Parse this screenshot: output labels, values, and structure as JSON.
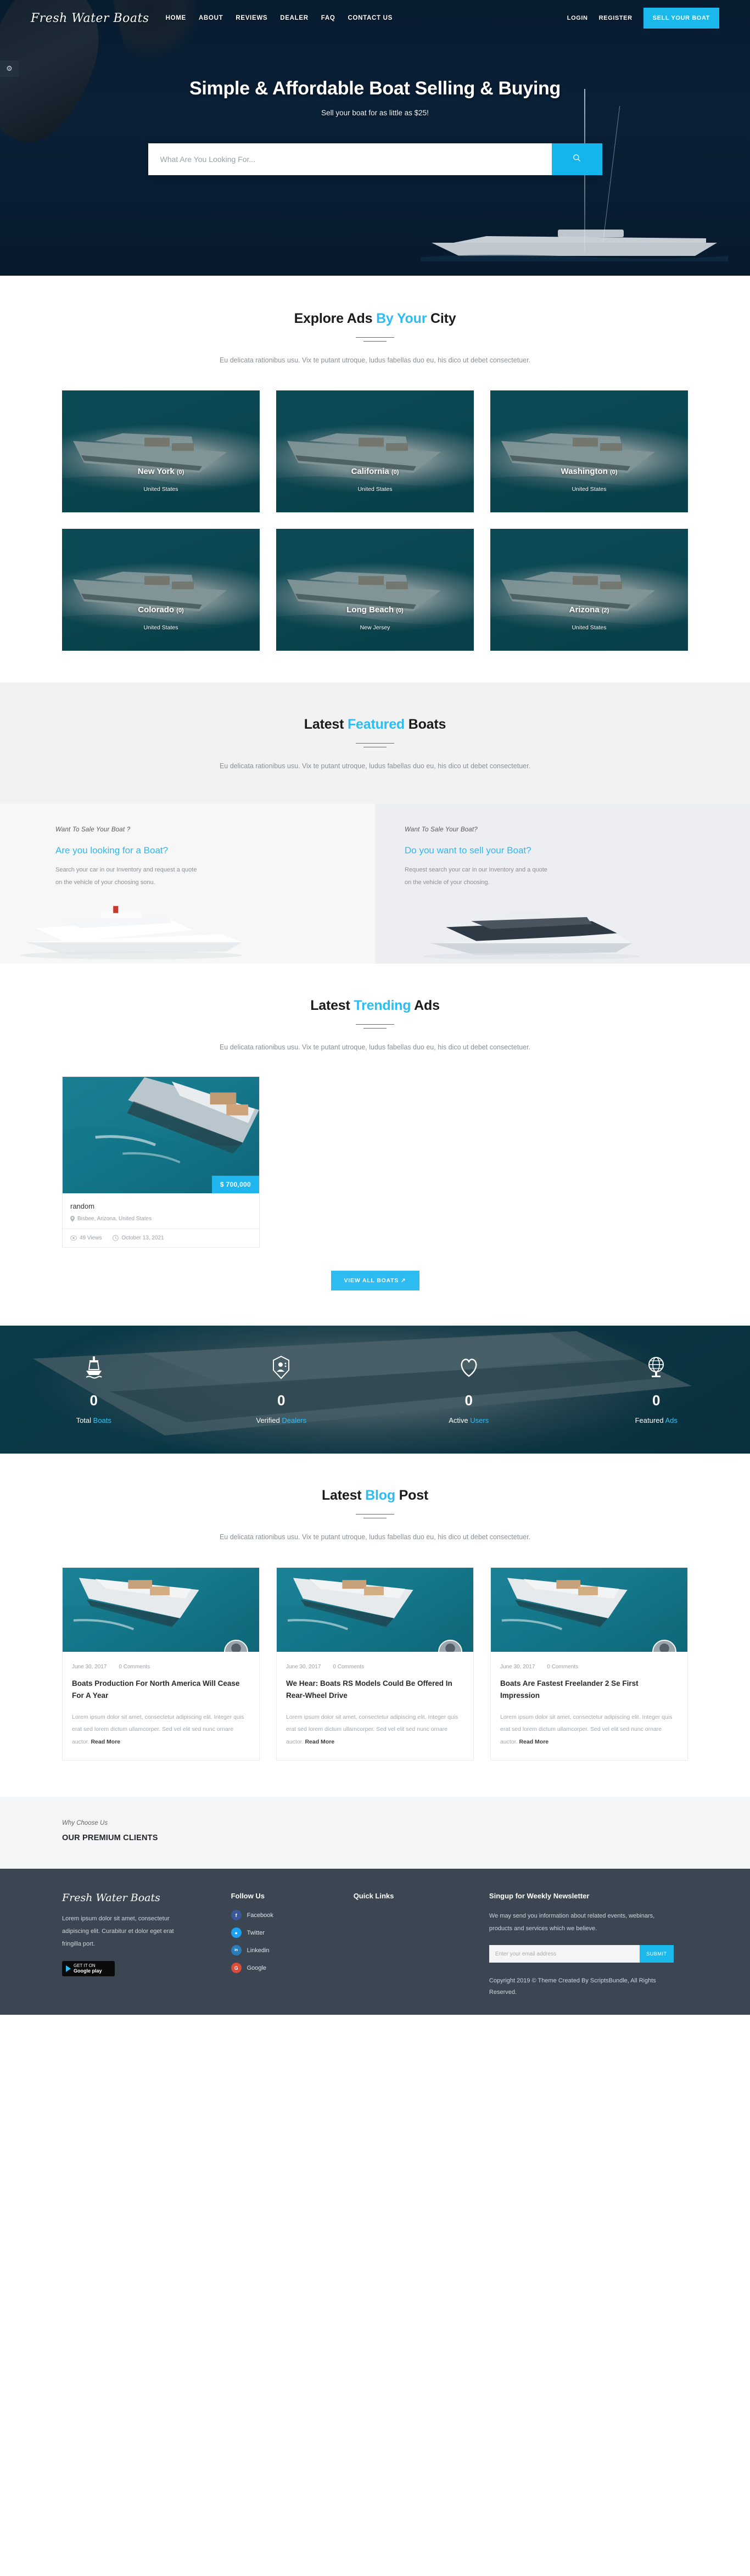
{
  "brand": {
    "name": "Fresh Water Boats"
  },
  "nav": {
    "links": [
      {
        "label": "HOME"
      },
      {
        "label": "ABOUT"
      },
      {
        "label": "REVIEWS"
      },
      {
        "label": "DEALER"
      },
      {
        "label": "FAQ"
      },
      {
        "label": "CONTACT US"
      }
    ],
    "login_label": "LOGIN",
    "register_label": "REGISTER",
    "sell_label": "SELL YOUR BOAT",
    "settings_icon": "gear-icon"
  },
  "hero": {
    "title": "Simple & Affordable Boat Selling & Buying",
    "subtitle": "Sell your boat for as little as $25!",
    "search_placeholder": "What Are You Looking For...",
    "search_value": "",
    "search_icon": "search-icon"
  },
  "city_section": {
    "title_pre": "Explore Ads ",
    "title_hl": "By Your",
    "title_post": " City",
    "desc": "Eu delicata rationibus usu. Vix te putant utroque, ludus fabellas duo eu, his dico ut debet consectetuer.",
    "cards": [
      {
        "name": "New York",
        "count": "(0)",
        "country": "United States"
      },
      {
        "name": "California",
        "count": "(0)",
        "country": "United States"
      },
      {
        "name": "Washington",
        "count": "(0)",
        "country": "United States"
      },
      {
        "name": "Colorado",
        "count": "(0)",
        "country": "United States"
      },
      {
        "name": "Long Beach",
        "count": "(0)",
        "country": "New Jersey"
      },
      {
        "name": "Arizona",
        "count": "(2)",
        "country": "United States"
      }
    ]
  },
  "featured_section": {
    "title_pre": "Latest ",
    "title_hl": "Featured",
    "title_post": " Boats",
    "desc": "Eu delicata rationibus usu. Vix te putant utroque, ludus fabellas duo eu, his dico ut debet consectetuer.",
    "promos": [
      {
        "kicker": "Want To Sale Your Boat ?",
        "title": "Are you looking for a Boat?",
        "text": "Search your car in our Inventory and request a quote on the vehicle of your choosing sonu."
      },
      {
        "kicker": "Want To Sale Your Boat?",
        "title": "Do you want to sell your Boat?",
        "text": "Request search your car in our Inventory and a quote on the vehicle of your choosing."
      }
    ]
  },
  "trending_section": {
    "title_pre": "Latest ",
    "title_hl": "Trending",
    "title_post": " Ads",
    "desc": "Eu delicata rationibus usu. Vix te putant utroque, ludus fabellas duo eu, his dico ut debet consectetuer.",
    "view_all_label": "VIEW ALL BOATS",
    "view_all_icon": "external-link-icon",
    "ads": [
      {
        "price": "$ 700,000",
        "title": "random",
        "location": "Bisbee, Arizona, United States",
        "views": "49 Views",
        "date": "October 13, 2021",
        "location_icon": "map-pin-icon",
        "views_icon": "eye-icon",
        "date_icon": "clock-icon"
      }
    ]
  },
  "stats": [
    {
      "icon": "ship-icon",
      "value": "0",
      "label_pre": "Total ",
      "label_hl": "Boats"
    },
    {
      "icon": "badge-user-icon",
      "value": "0",
      "label_pre": "Verified ",
      "label_hl": "Dealers"
    },
    {
      "icon": "heart-icon",
      "value": "0",
      "label_pre": "Active ",
      "label_hl": "Users"
    },
    {
      "icon": "globe-icon",
      "value": "0",
      "label_pre": "Featured ",
      "label_hl": "Ads"
    }
  ],
  "blog_section": {
    "title_pre": "Latest ",
    "title_hl": "Blog",
    "title_post": " Post",
    "desc": "Eu delicata rationibus usu. Vix te putant utroque, ludus fabellas duo eu, his dico ut debet consectetuer.",
    "posts": [
      {
        "date": "June 30, 2017",
        "comments": "0 Comments",
        "title": "Boats Production For North America Will Cease For A Year",
        "text": "Lorem ipsum dolor sit amet, consectetur adipiscing elit. Integer quis erat sed lorem dictum ullamcorper. Sed vel elit sed nunc ornare auctor.",
        "read_more": "Read More"
      },
      {
        "date": "June 30, 2017",
        "comments": "0 Comments",
        "title": "We Hear: Boats RS Models Could Be Offered In Rear-Wheel Drive",
        "text": "Lorem ipsum dolor sit amet, consectetur adipiscing elit. Integer quis erat sed lorem dictum ullamcorper. Sed vel elit sed nunc ornare auctor.",
        "read_more": "Read More"
      },
      {
        "date": "June 30, 2017",
        "comments": "0 Comments",
        "title": "Boats Are Fastest Freelander 2 Se First Impression",
        "text": "Lorem ipsum dolor sit amet, consectetur adipiscing elit. Integer quis erat sed lorem dictum ullamcorper. Sed vel elit sed nunc ornare auctor.",
        "read_more": "Read More"
      }
    ]
  },
  "clients": {
    "kicker": "Why Choose Us",
    "title": "OUR PREMIUM CLIENTS"
  },
  "footer": {
    "brand": "Fresh Water Boats",
    "about": "Lorem ipsum dolor sit amet, consectetur adipiscing elit. Curabitur et dolor eget erat fringilla port.",
    "gplay_small": "GET IT ON",
    "gplay_big": "Google play",
    "follow_head": "Follow Us",
    "socials": [
      {
        "label": "Facebook",
        "icon": "facebook-icon",
        "color": "#3b5998",
        "glyph": "f"
      },
      {
        "label": "Twitter",
        "icon": "twitter-icon",
        "color": "#1da1f2",
        "glyph": "t"
      },
      {
        "label": "Linkedin",
        "icon": "linkedin-icon",
        "color": "#2b7bb9",
        "glyph": "in"
      },
      {
        "label": "Google",
        "icon": "google-icon",
        "color": "#dd4b39",
        "glyph": "G"
      }
    ],
    "quick_head": "Quick Links",
    "newsletter_head": "Singup for Weekly Newsletter",
    "newsletter_text": "We may send you information about related events, webinars, products and services which we believe.",
    "email_placeholder": "Enter your email address",
    "email_value": "",
    "submit_label": "SUBMIT",
    "copyright": "Copyright 2019 © Theme Created By ScriptsBundle, All Rights Reserved."
  },
  "colors": {
    "accent": "#1bb8ec",
    "accent_light": "#2cbcf2",
    "footer_bg": "#3b4652",
    "dark": "#1b1b1b"
  }
}
